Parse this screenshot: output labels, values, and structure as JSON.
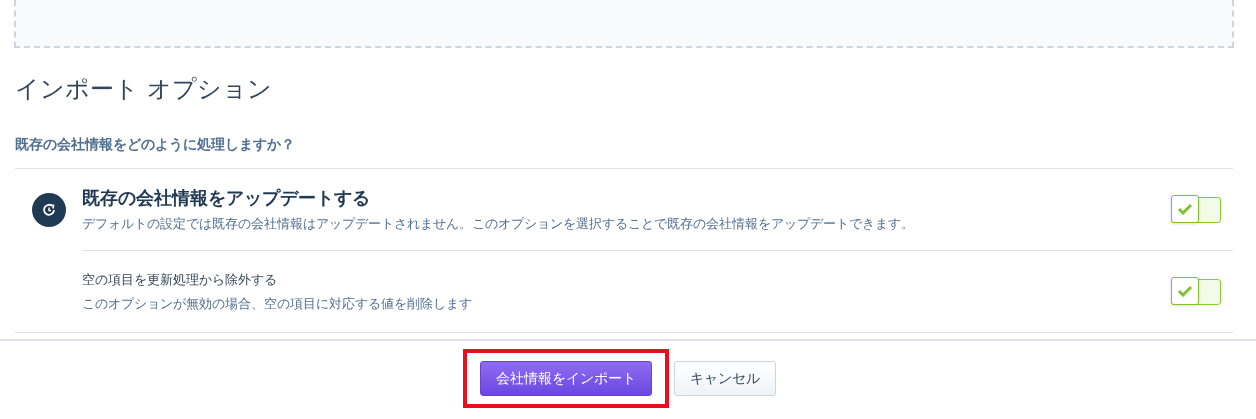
{
  "section_title": "インポート オプション",
  "question": "既存の会社情報をどのように処理しますか？",
  "options": [
    {
      "kind": "main",
      "title": "既存の会社情報をアップデートする",
      "description": "デフォルトの設定では既存の会社情報はアップデートされません。このオプションを選択することで既存の会社情報をアップデートできます。",
      "checked": true
    },
    {
      "kind": "sub",
      "title": "空の項目を更新処理から除外する",
      "description": "このオプションが無効の場合、空の項目に対応する値を削除します",
      "checked": true
    }
  ],
  "buttons": [
    {
      "kind": "primary",
      "label": "会社情報をインポート",
      "highlighted": true
    },
    {
      "kind": "secondary",
      "label": "キャンセル",
      "highlighted": false
    }
  ]
}
